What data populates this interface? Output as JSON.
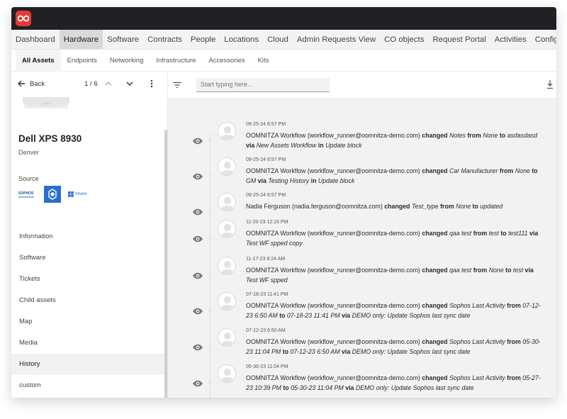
{
  "app": {
    "brand_color": "#e53935",
    "logo_icon": "infinity-icon"
  },
  "nav": {
    "items": [
      "Dashboard",
      "Hardware",
      "Software",
      "Contracts",
      "People",
      "Locations",
      "Cloud",
      "Admin Requests View",
      "CO objects",
      "Request Portal",
      "Activities",
      "Configuratio"
    ],
    "active_index": 1,
    "help_icon": "help-circle-icon"
  },
  "subnav": {
    "items": [
      "All Assets",
      "Endpoints",
      "Networking",
      "Infrastructure",
      "Accessories",
      "Kits"
    ],
    "active_index": 0
  },
  "left": {
    "back_label": "Back",
    "pager": "1 / 6",
    "device_name": "Dell XPS 8930",
    "location": "Denver",
    "source_label": "Source",
    "sources": [
      "SOPHOS",
      "CrowdStrike",
      "Intune"
    ],
    "menu": [
      "Information",
      "Software",
      "Tickets",
      "Child assets",
      "Map",
      "Media",
      "History",
      "custom"
    ],
    "menu_active_index": 6
  },
  "toolbar": {
    "search_placeholder": "Start typing here..."
  },
  "history": [
    {
      "time": "09-25-24 8:57 PM",
      "parts": [
        [
          "t",
          "OOMNITZA Workflow (workflow_runner@oomnitza-demo.com) "
        ],
        [
          "b",
          "changed "
        ],
        [
          "i",
          "Notes "
        ],
        [
          "b",
          "from "
        ],
        [
          "i",
          "None "
        ],
        [
          "b",
          "to "
        ],
        [
          "i",
          "asdasdasd "
        ],
        [
          "b",
          "via "
        ],
        [
          "i",
          "New Assets Workflow "
        ],
        [
          "b",
          "in "
        ],
        [
          "i",
          "Update block"
        ]
      ]
    },
    {
      "time": "09-25-24 8:57 PM",
      "parts": [
        [
          "t",
          "OOMNITZA Workflow (workflow_runner@oomnitza-demo.com) "
        ],
        [
          "b",
          "changed "
        ],
        [
          "i",
          "Car Manufacturer "
        ],
        [
          "b",
          "from "
        ],
        [
          "i",
          "None "
        ],
        [
          "b",
          "to "
        ],
        [
          "i",
          "GM "
        ],
        [
          "b",
          "via "
        ],
        [
          "i",
          "Testing History "
        ],
        [
          "b",
          "in "
        ],
        [
          "i",
          "Update block"
        ]
      ]
    },
    {
      "time": "09-25-24 8:57 PM",
      "parts": [
        [
          "t",
          "Nadia Ferguson (nadia.ferguson@oomnitza.com) "
        ],
        [
          "b",
          "changed "
        ],
        [
          "i",
          "Test_type "
        ],
        [
          "b",
          "from "
        ],
        [
          "i",
          "None "
        ],
        [
          "b",
          "to "
        ],
        [
          "i",
          "updated"
        ]
      ]
    },
    {
      "time": "11-20-23 12:16 PM",
      "parts": [
        [
          "t",
          "OOMNITZA Workflow (workflow_runner@oomnitza-demo.com) "
        ],
        [
          "b",
          "changed "
        ],
        [
          "i",
          "qaa test "
        ],
        [
          "b",
          "from "
        ],
        [
          "i",
          "test "
        ],
        [
          "b",
          "to "
        ],
        [
          "i",
          "test111 "
        ],
        [
          "b",
          "via "
        ],
        [
          "i",
          "Test WF spped copy"
        ]
      ]
    },
    {
      "time": "11-17-23 6:24 AM",
      "parts": [
        [
          "t",
          "OOMNITZA Workflow (workflow_runner@oomnitza-demo.com) "
        ],
        [
          "b",
          "changed "
        ],
        [
          "i",
          "qaa test "
        ],
        [
          "b",
          "from "
        ],
        [
          "i",
          "None "
        ],
        [
          "b",
          "to "
        ],
        [
          "i",
          "test "
        ],
        [
          "b",
          "via "
        ],
        [
          "i",
          "Test WF spped"
        ]
      ]
    },
    {
      "time": "07-18-23 11:41 PM",
      "parts": [
        [
          "t",
          "OOMNITZA Workflow (workflow_runner@oomnitza-demo.com) "
        ],
        [
          "b",
          "changed "
        ],
        [
          "i",
          "Sophos Last Activity "
        ],
        [
          "b",
          "from "
        ],
        [
          "i",
          "07-12-23 6:50 AM "
        ],
        [
          "b",
          "to "
        ],
        [
          "i",
          "07-18-23 11:41 PM "
        ],
        [
          "b",
          "via "
        ],
        [
          "i",
          "DEMO only: Update Sophos last sync date"
        ]
      ]
    },
    {
      "time": "07-12-23 6:50 AM",
      "parts": [
        [
          "t",
          "OOMNITZA Workflow (workflow_runner@oomnitza-demo.com) "
        ],
        [
          "b",
          "changed "
        ],
        [
          "i",
          "Sophos Last Activity "
        ],
        [
          "b",
          "from "
        ],
        [
          "i",
          "05-30-23 11:04 PM "
        ],
        [
          "b",
          "to "
        ],
        [
          "i",
          "07-12-23 6:50 AM "
        ],
        [
          "b",
          "via "
        ],
        [
          "i",
          "DEMO only: Update Sophos last sync date"
        ]
      ]
    },
    {
      "time": "05-30-23 11:04 PM",
      "parts": [
        [
          "t",
          "OOMNITZA Workflow (workflow_runner@oomnitza-demo.com) "
        ],
        [
          "b",
          "changed "
        ],
        [
          "i",
          "Sophos Last Activity "
        ],
        [
          "b",
          "from "
        ],
        [
          "i",
          "05-27-23 10:39 PM "
        ],
        [
          "b",
          "to "
        ],
        [
          "i",
          "05-30-23 11:04 PM "
        ],
        [
          "b",
          "via "
        ],
        [
          "i",
          "DEMO only: Update Sophos last sync date"
        ]
      ]
    }
  ]
}
